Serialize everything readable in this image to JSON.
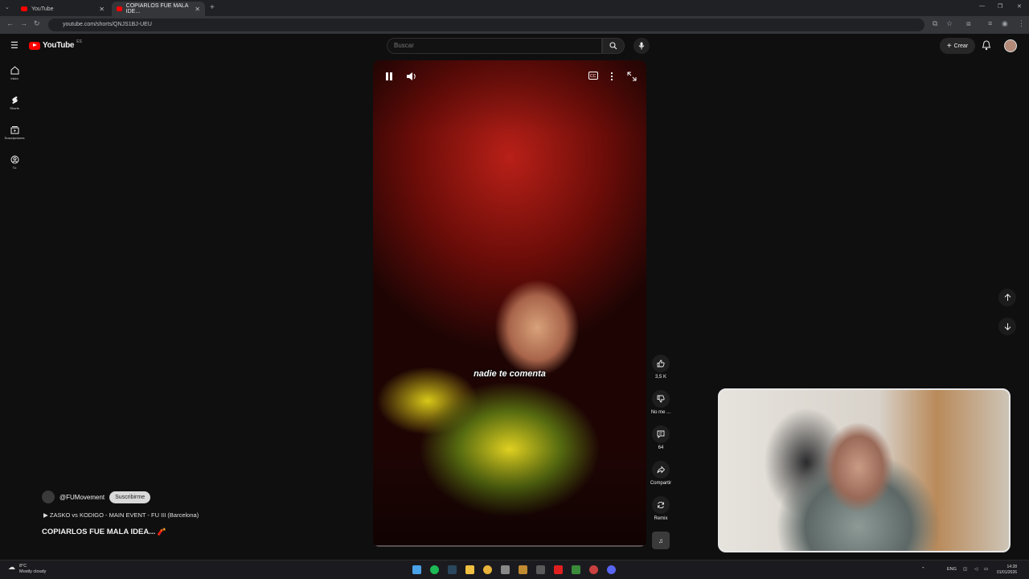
{
  "browser": {
    "tabs": [
      {
        "label": "YouTube"
      },
      {
        "label": "COPIARLOS FUE MALA IDE..."
      }
    ],
    "url": "youtube.com/shorts/QNJS1BJ-UEU"
  },
  "header": {
    "logo_text": "YouTube",
    "country_code": "ES",
    "search_placeholder": "Buscar",
    "create_label": "Crear"
  },
  "sidebar": {
    "items": [
      {
        "label": "Inicio",
        "icon": "home-icon"
      },
      {
        "label": "Shorts",
        "icon": "shorts-icon"
      },
      {
        "label": "Suscripciones",
        "icon": "subscriptions-icon"
      },
      {
        "label": "Tú",
        "icon": "you-icon"
      }
    ]
  },
  "video": {
    "caption": "nadie te comenta",
    "channel": "@FUMovement",
    "subscribe_label": "Suscribirme",
    "playlist": "ZASKO vs KODIGO - MAIN EVENT - FU III (Barcelona)",
    "title": "COPIARLOS FUE MALA IDEA...",
    "title_emoji": "🧨"
  },
  "actions": {
    "likes": "3,5 K",
    "dislike_label": "No me ...",
    "comments": "64",
    "share_label": "Compartir",
    "remix_label": "Remix"
  },
  "taskbar": {
    "temperature": "8°C",
    "weather": "Mostly cloudy",
    "language": "ENG",
    "time": "14:28",
    "date": "01/01/2026"
  },
  "colors": {
    "brand_red": "#ff0000",
    "bg": "#0f0f0f"
  }
}
